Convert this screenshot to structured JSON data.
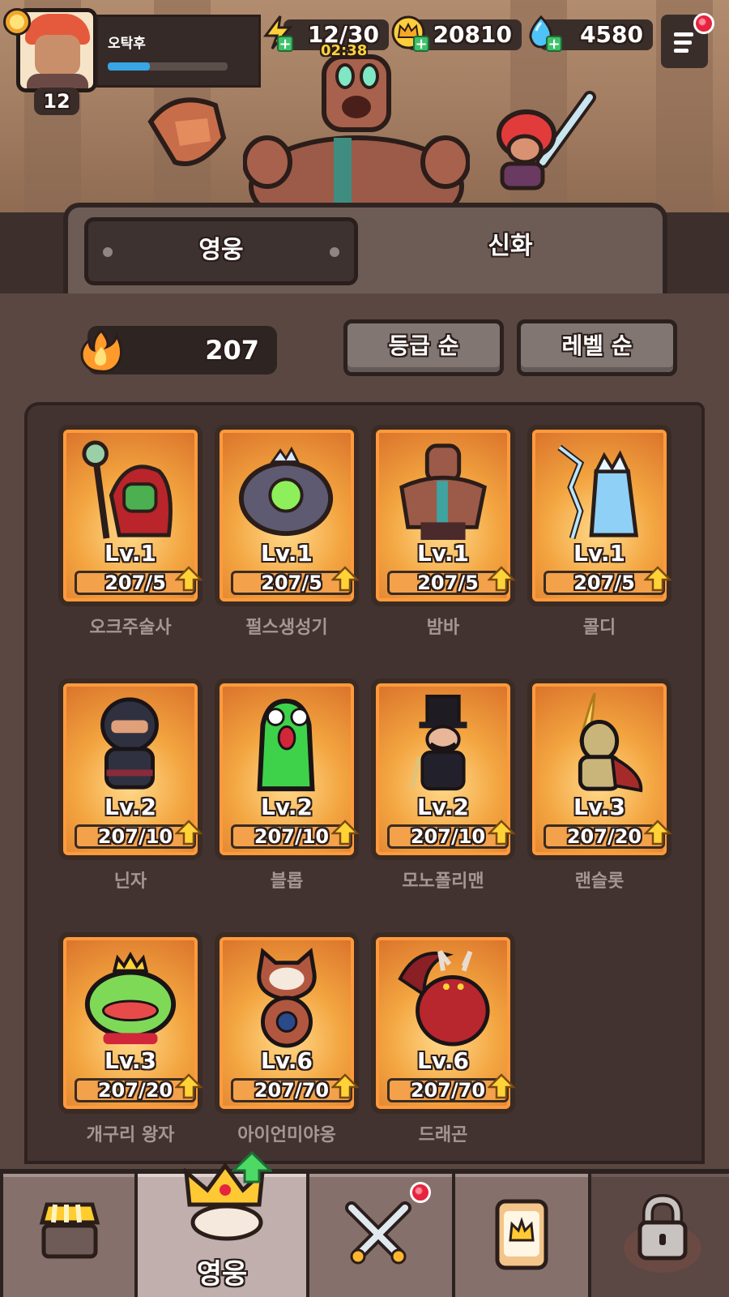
{
  "player": {
    "name": "오탁후",
    "level": "12",
    "xp_progress": 0.35
  },
  "resources": {
    "energy": "12/30",
    "energy_timer": "02:38",
    "crowns": "20810",
    "gems": "4580"
  },
  "tabs": [
    {
      "label": "영웅",
      "active": true
    },
    {
      "label": "신화",
      "active": false
    }
  ],
  "power": "207",
  "sort_buttons": [
    "등급 순",
    "레벨 순"
  ],
  "heroes": [
    {
      "name": "오크주술사",
      "level": "Lv.1",
      "progress": "207/5",
      "icon": "orc-shaman-icon"
    },
    {
      "name": "펄스생성기",
      "level": "Lv.1",
      "progress": "207/5",
      "icon": "pulse-generator-icon"
    },
    {
      "name": "밤바",
      "level": "Lv.1",
      "progress": "207/5",
      "icon": "bamba-golem-icon"
    },
    {
      "name": "콜디",
      "level": "Lv.1",
      "progress": "207/5",
      "icon": "coldy-ice-icon"
    },
    {
      "name": "닌자",
      "level": "Lv.2",
      "progress": "207/10",
      "icon": "ninja-icon"
    },
    {
      "name": "블롭",
      "level": "Lv.2",
      "progress": "207/10",
      "icon": "blob-icon"
    },
    {
      "name": "모노폴리맨",
      "level": "Lv.2",
      "progress": "207/10",
      "icon": "monopoly-man-icon"
    },
    {
      "name": "랜슬롯",
      "level": "Lv.3",
      "progress": "207/20",
      "icon": "lancelot-knight-icon"
    },
    {
      "name": "개구리 왕자",
      "level": "Lv.3",
      "progress": "207/20",
      "icon": "frog-prince-icon"
    },
    {
      "name": "아이언미야옹",
      "level": "Lv.6",
      "progress": "207/70",
      "icon": "iron-meow-icon"
    },
    {
      "name": "드래곤",
      "level": "Lv.6",
      "progress": "207/70",
      "icon": "dragon-icon"
    }
  ],
  "bottom_nav": [
    {
      "id": "shop",
      "label": "",
      "icon": "shop-icon"
    },
    {
      "id": "heroes",
      "label": "영웅",
      "icon": "crown-icon",
      "active": true
    },
    {
      "id": "battle",
      "label": "",
      "icon": "crossed-swords-icon"
    },
    {
      "id": "cards",
      "label": "",
      "icon": "card-icon"
    },
    {
      "id": "locked",
      "label": "",
      "icon": "lock-icon"
    }
  ],
  "colors": {
    "card_orange": "#f3a540",
    "xp_blue": "#36a6e6",
    "plus_green": "#3fc16a",
    "notification_red": "#e5243f"
  }
}
